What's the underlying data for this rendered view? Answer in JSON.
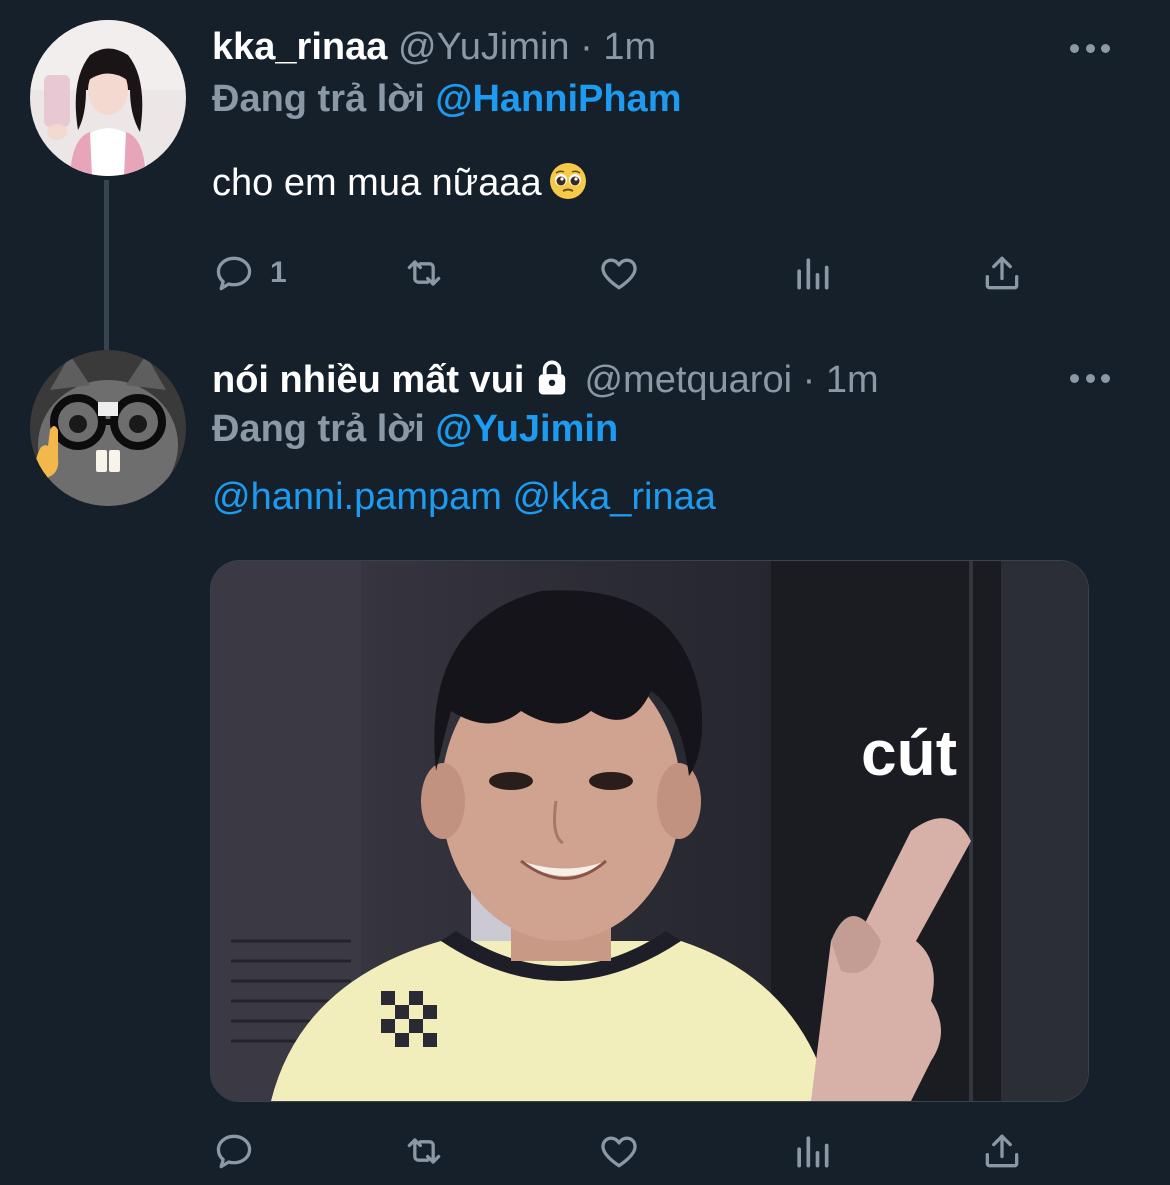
{
  "tweets": [
    {
      "display_name": "kka_rinaa",
      "handle": "@YuJimin",
      "separator": "·",
      "time": "1m",
      "replying_prefix": "Đang trả lời",
      "replying_to": "@HanniPham",
      "text": "cho em mua nữaaa",
      "emoji": "pleading-face",
      "reply_count": "1"
    },
    {
      "display_name": "nói nhiều mất vui",
      "locked": true,
      "handle": "@metquaroi",
      "separator": "·",
      "time": "1m",
      "replying_prefix": "Đang trả lời",
      "replying_to": "@YuJimin",
      "mentions": [
        "@hanni.pampam",
        "@kka_rinaa"
      ],
      "media_caption": "cút"
    }
  ],
  "icons": [
    "reply-icon",
    "retweet-icon",
    "like-icon",
    "analytics-icon",
    "share-icon",
    "more-icon",
    "lock-icon"
  ],
  "colors": {
    "background": "#15202b",
    "accent": "#1d9bf0",
    "muted": "#8b98a5"
  }
}
